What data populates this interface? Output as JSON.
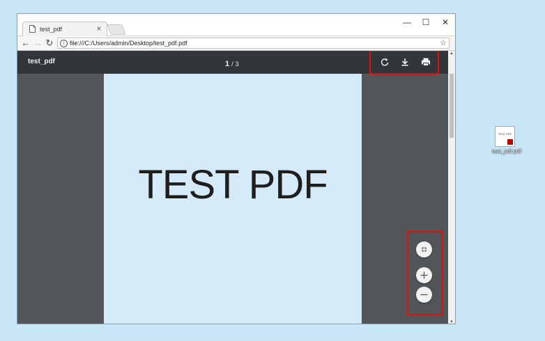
{
  "browser": {
    "tab_title": "test_pdf",
    "tab_close": "×",
    "window_controls": {
      "minimize": "—",
      "maximize": "☐",
      "close": "✕"
    },
    "url": "file:///C:/Users/admin/Desktop/test_pdf.pdf",
    "nav": {
      "back": "←",
      "forward": "→",
      "reload": "↻"
    },
    "bookmark": "☆"
  },
  "pdf_viewer": {
    "title": "test_pdf",
    "current_page": "1",
    "separator": "/",
    "total_pages": "3",
    "toolbar_icons": [
      "rotate-icon",
      "download-icon",
      "print-icon"
    ],
    "page_content": "TEST PDF",
    "zoom_icons": [
      "fit-to-page-icon",
      "zoom-in-icon",
      "zoom-out-icon"
    ]
  },
  "desktop": {
    "file_label": "test_pdf.pdf",
    "file_thumb_text": "TEST PDF"
  },
  "colors": {
    "highlight": "#e01010",
    "pdf_toolbar": "#323639",
    "viewer_bg": "#525659",
    "page_bg": "#d4eaf8",
    "desktop_bg": "#c8e6f6"
  }
}
